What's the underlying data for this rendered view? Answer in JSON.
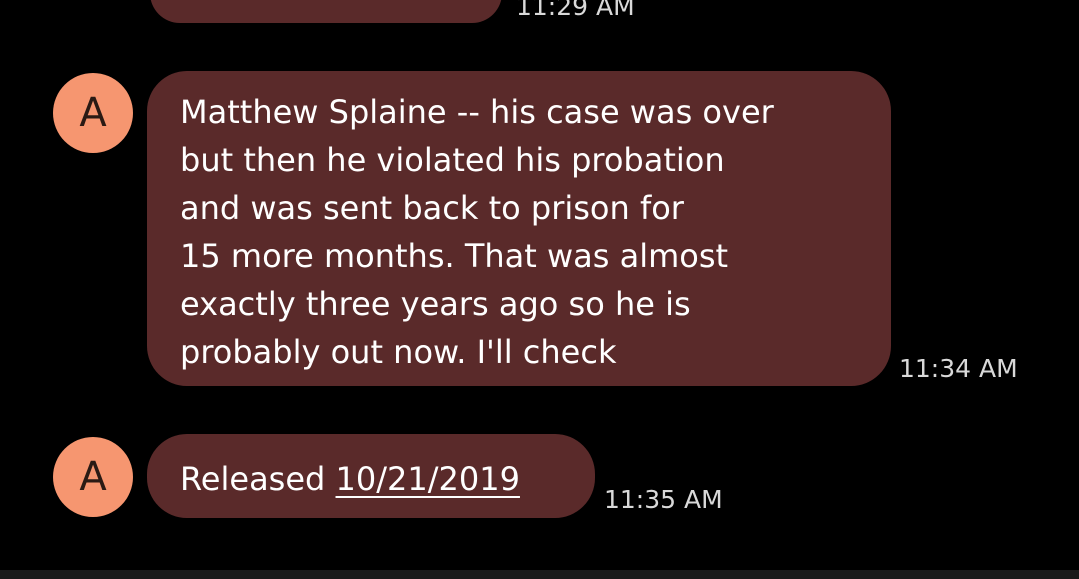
{
  "conversation": {
    "previous_message": {
      "timestamp": "11:29 AM"
    },
    "messages": [
      {
        "avatar_initial": "A",
        "lines": [
          "Matthew Splaine -- his case was over",
          "but then he violated his probation",
          "and was sent back to prison for",
          "15 more months. That was almost",
          "exactly three years ago so he is",
          "probably out now. I'll check"
        ],
        "timestamp": "11:34 AM"
      },
      {
        "avatar_initial": "A",
        "text_prefix": "Released ",
        "link_text": "10/21/2019",
        "timestamp": "11:35 AM"
      }
    ]
  },
  "colors": {
    "background": "#000000",
    "bubble": "#5a2a2a",
    "avatar": "#f69670",
    "timestamp": "#d9d9d9"
  }
}
